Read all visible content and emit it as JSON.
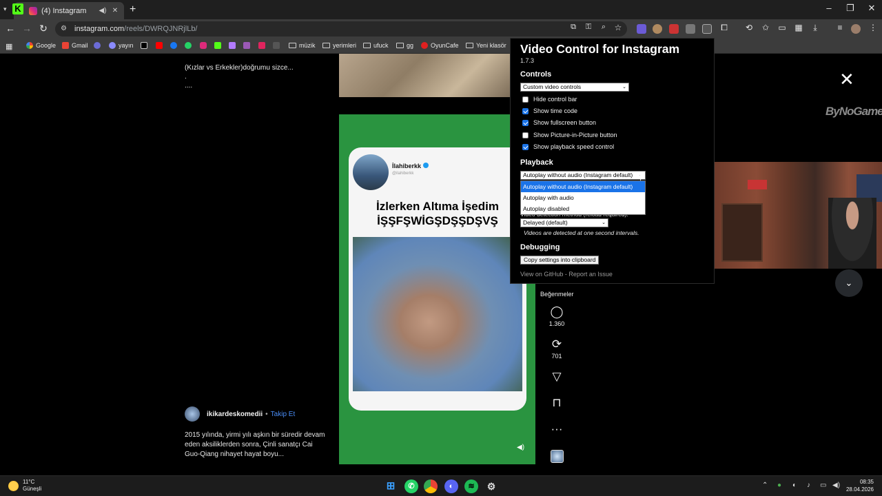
{
  "browser": {
    "tab_title": "(4) Instagram",
    "url_host": "instagram.com",
    "url_path": "/reels/DWRQJNRjlLb/",
    "bookmarks": [
      "Google",
      "Gmail",
      "yayın",
      "müzik",
      "yerimleri",
      "ufuck",
      "gg",
      "OyunCafe",
      "Yeni klasör"
    ]
  },
  "page": {
    "caption_top_line1": "(Kızlar vs Erkekler)doğrumu sizce...",
    "caption_top_line2": ".",
    "caption_top_line3": "....",
    "reel": {
      "card_username": "İlahiberkk",
      "card_handle": "@ilahiberkk",
      "headline_line1": "İzlerken Altıma İşedim",
      "headline_line2": "İŞŞFŞWİGŞDŞŞDŞVŞ"
    },
    "creator": {
      "name": "ikikardeskomedii",
      "separator": "•",
      "follow": "Takip Et"
    },
    "caption_bottom": "2015 yılında, yirmi yılı aşkın bir süredir devam eden aksiliklerden sonra, Çinli sanatçı Cai Guo-Qiang nihayet hayat boyu...",
    "actions": {
      "likes_label": "Beğenmeler",
      "comments_count": "1.360",
      "reposts_count": "701"
    },
    "brand_mark": "ByNoGame"
  },
  "popup": {
    "title": "Video Control for Instagram",
    "version": "1.7.3",
    "controls_heading": "Controls",
    "controls_select": "Custom video controls",
    "checkboxes": [
      {
        "label": "Hide control bar",
        "checked": false
      },
      {
        "label": "Show time code",
        "checked": true
      },
      {
        "label": "Show fullscreen button",
        "checked": true
      },
      {
        "label": "Show Picture-in-Picture button",
        "checked": false
      },
      {
        "label": "Show playback speed control",
        "checked": true
      }
    ],
    "playback_heading": "Playback",
    "playback_select": "Autoplay without audio (Instagram default)",
    "playback_options": [
      "Autoplay without audio (Instagram default)",
      "Autoplay with audio",
      "Autoplay disabled"
    ],
    "detection_label": "Video detection method (reload required):",
    "detection_select": "Delayed (default)",
    "detection_note": "Videos are detected at one second intervals.",
    "debugging_heading": "Debugging",
    "copy_button": "Copy settings into clipboard",
    "github_link": "View on GitHub",
    "footer_sep": "-",
    "issue_link": "Report an Issue"
  },
  "taskbar": {
    "temperature": "11°C",
    "weather": "Güneşli",
    "time": "08:35",
    "date": "28.04.2026"
  }
}
